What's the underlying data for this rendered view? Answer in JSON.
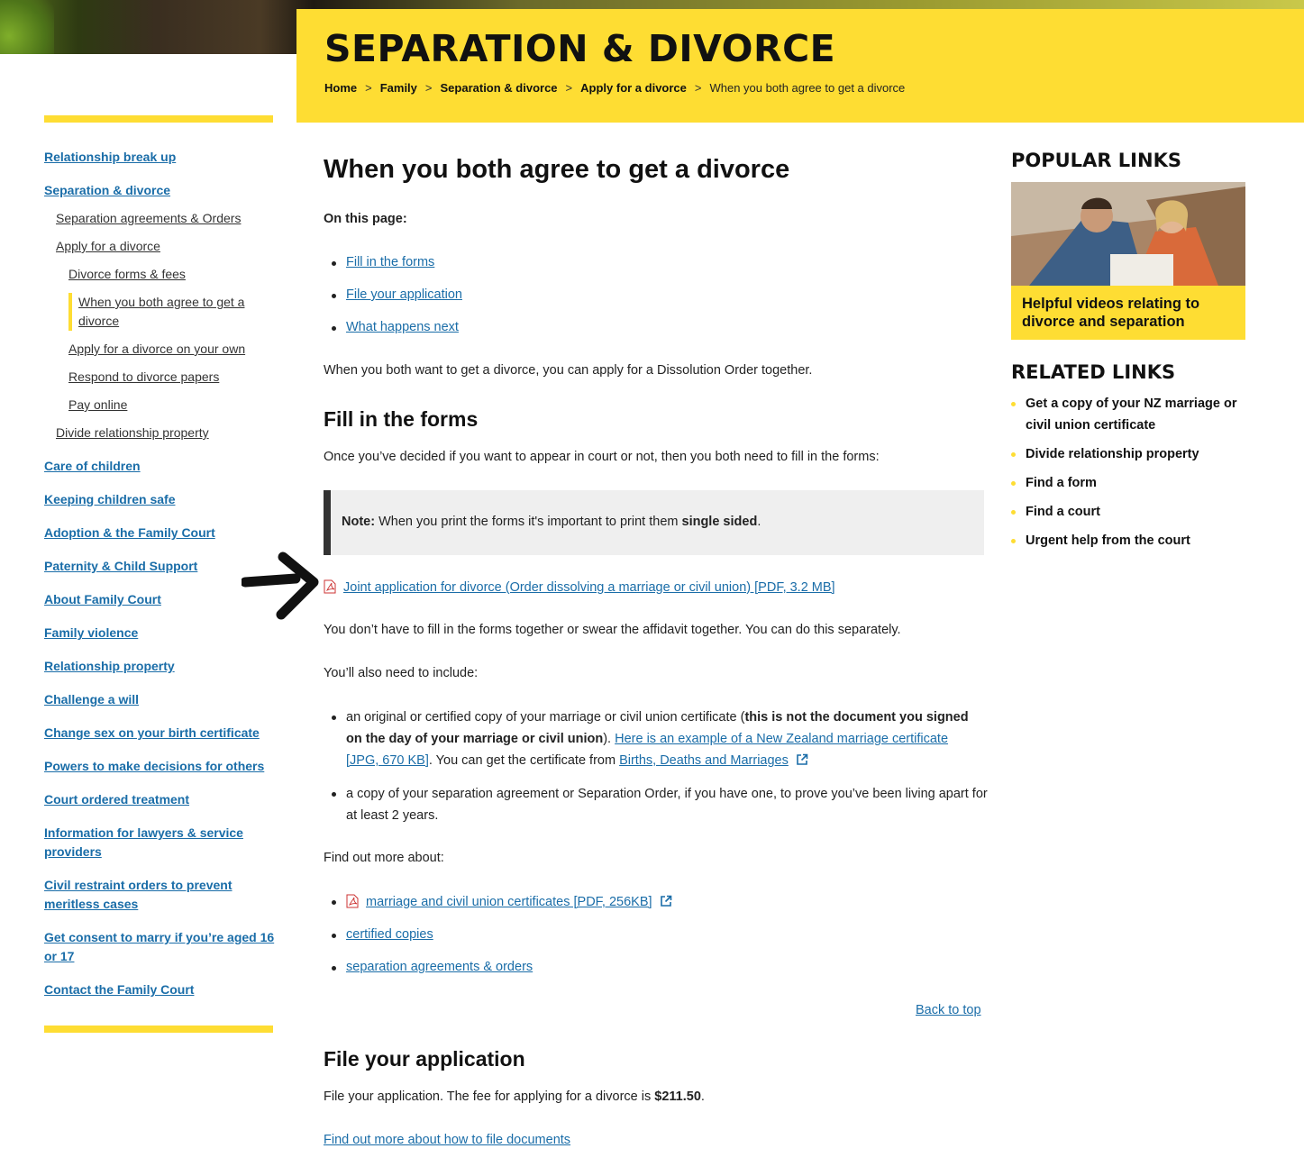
{
  "header": {
    "site_title": "SEPARATION & DIVORCE",
    "breadcrumb": [
      "Home",
      "Family",
      "Separation & divorce",
      "Apply for a divorce"
    ],
    "breadcrumb_current": "When you both agree to get a divorce"
  },
  "sidebar": {
    "items": [
      "Relationship break up",
      "Separation & divorce",
      "Separation agreements & Orders",
      "Apply for a divorce",
      "Divorce forms & fees",
      "When you both agree to get a divorce",
      "Apply for a divorce on your own",
      "Respond to divorce papers",
      "Pay online",
      "Divide relationship property",
      "Care of children",
      "Keeping children safe",
      "Adoption & the Family Court",
      "Paternity & Child Support",
      "About Family Court",
      "Family violence",
      "Relationship property",
      "Challenge a will",
      "Change sex on your birth certificate",
      "Powers to make decisions for others",
      "Court ordered treatment",
      "Information for lawyers & service providers",
      "Civil restraint orders to prevent meritless cases",
      "Get consent to marry if you’re aged 16 or 17",
      "Contact the Family Court"
    ]
  },
  "main": {
    "title": "When you both agree to get a divorce",
    "on_this_page_label": "On this page:",
    "toc": [
      "Fill in the forms",
      "File your application",
      "What happens next"
    ],
    "intro": "When you both want to get a divorce, you can apply for a Dissolution Order together.",
    "fill_heading": "Fill in the forms",
    "fill_text": "Once you’ve decided if you want to appear in court or not, then you both need to fill in the forms:",
    "note_label": "Note:",
    "note_text": " When you print the forms it's important to print them ",
    "note_bold": "single sided",
    "note_end": ".",
    "pdf_link": "Joint application for divorce (Order dissolving a marriage or civil union) [PDF, 3.2 MB]",
    "separately_text": "You don’t have to fill in the forms together or swear the affidavit together. You can do this separately.",
    "include_text": "You’ll also need to include:",
    "bullet1_a": "an original or certified copy of your marriage or civil union certificate (",
    "bullet1_bold": "this is not the document you signed on the day of your marriage or civil union",
    "bullet1_b": "). ",
    "bullet1_link": "Here is an example of a New Zealand marriage certificate [JPG, 670 KB]",
    "bullet1_c": ". You can get the certificate from ",
    "bullet1_link2": "Births, Deaths and Marriages",
    "bullet2": "a copy of your separation agreement or Separation Order, if you have one, to prove you’ve been living apart for at least 2 years.",
    "find_more": "Find out more about:",
    "more_links": [
      "marriage and civil union certificates [PDF, 256KB]",
      "certified copies",
      "separation agreements & orders"
    ],
    "back_to_top": "Back to top",
    "file_heading": "File your application",
    "file_text": "File your application. The fee for applying for a divorce is ",
    "fee": "$211.50",
    "file_end": ".",
    "file_link": "Find out more about how to file documents"
  },
  "right": {
    "popular_heading": "POPULAR LINKS",
    "promo_title": "Helpful videos relating to divorce and separation",
    "related_heading": "RELATED LINKS",
    "related": [
      "Get a copy of your NZ marriage or civil union certificate",
      "Divide relationship property",
      "Find a form",
      "Find a court",
      "Urgent help from the court"
    ]
  }
}
